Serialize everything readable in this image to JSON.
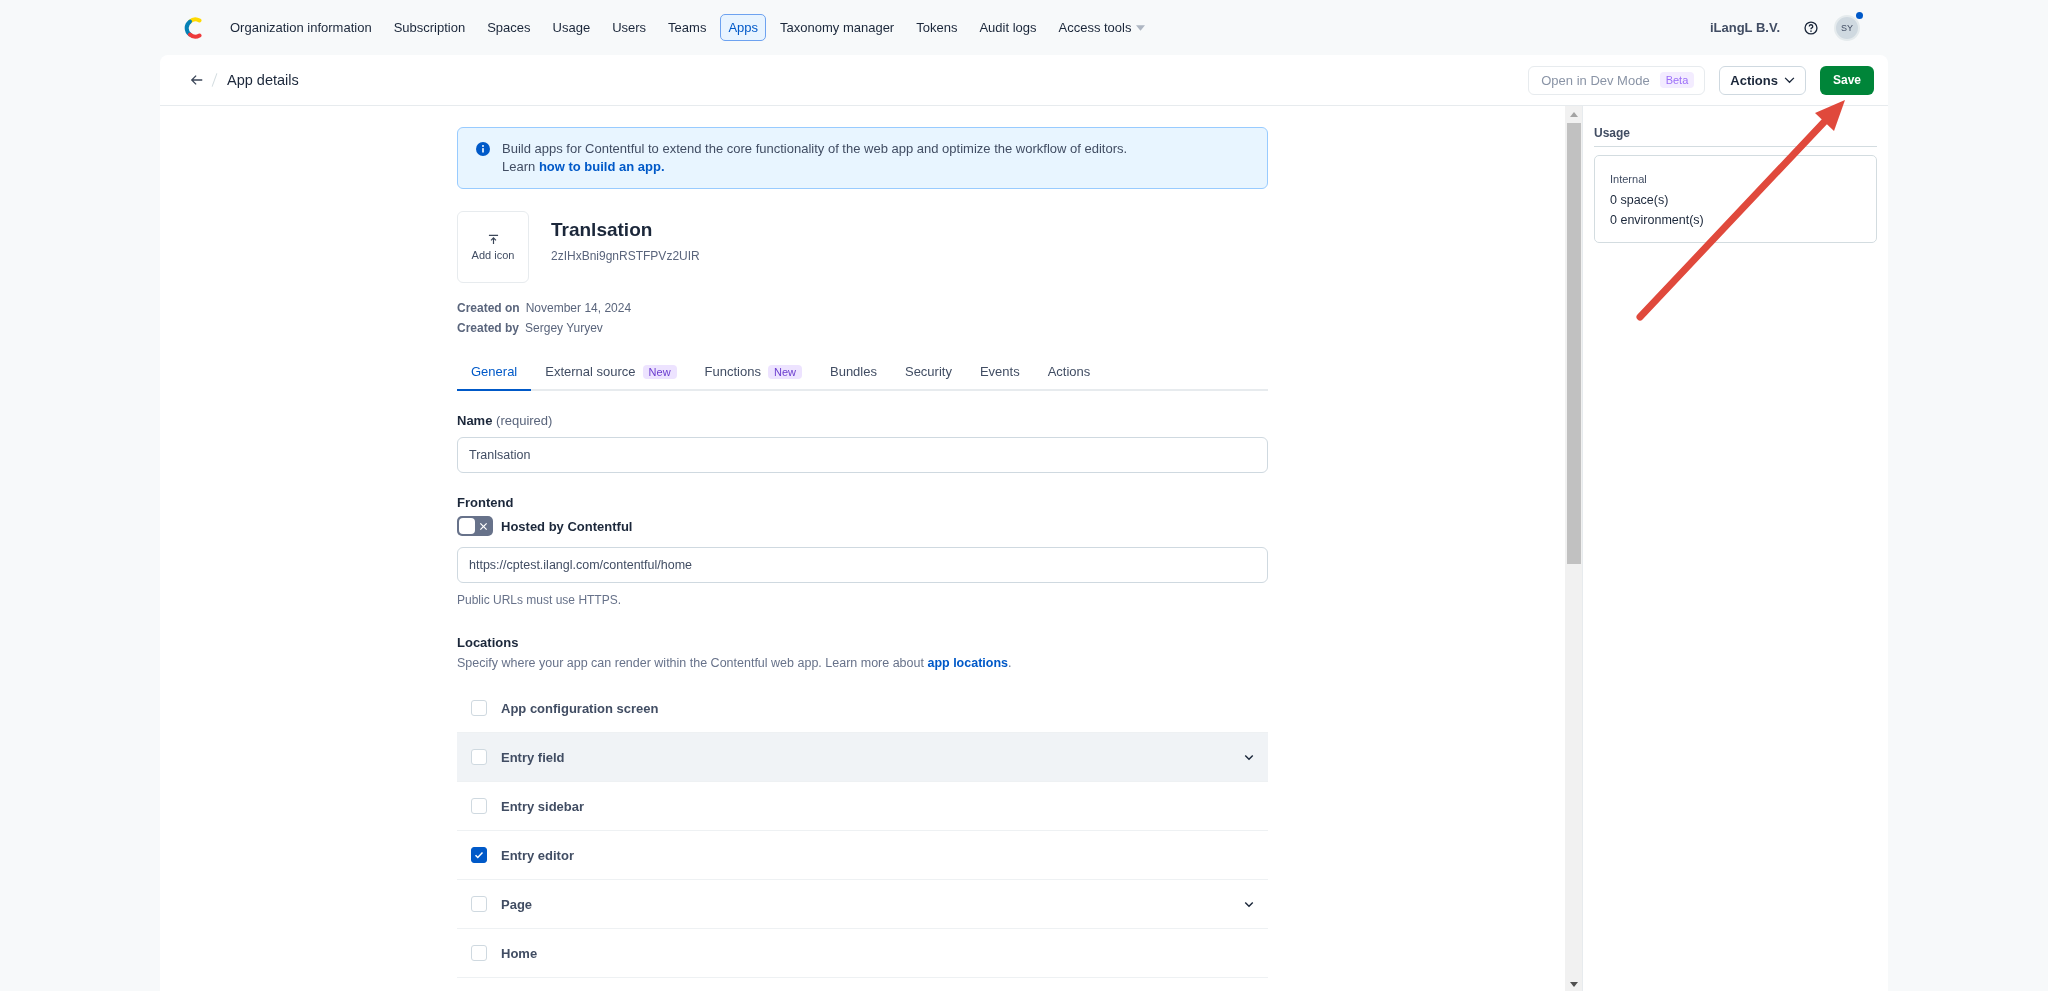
{
  "nav": {
    "items": [
      {
        "label": "Organization information",
        "selected": false,
        "kind": "link"
      },
      {
        "label": "Subscription",
        "selected": false,
        "kind": "link"
      },
      {
        "label": "Spaces",
        "selected": false,
        "kind": "link"
      },
      {
        "label": "Usage",
        "selected": false,
        "kind": "link"
      },
      {
        "label": "Users",
        "selected": false,
        "kind": "link"
      },
      {
        "label": "Teams",
        "selected": false,
        "kind": "link"
      },
      {
        "label": "Apps",
        "selected": true,
        "kind": "link"
      },
      {
        "label": "Taxonomy manager",
        "selected": false,
        "kind": "link"
      },
      {
        "label": "Tokens",
        "selected": false,
        "kind": "link"
      },
      {
        "label": "Audit logs",
        "selected": false,
        "kind": "link"
      },
      {
        "label": "Access tools",
        "selected": false,
        "kind": "menu"
      }
    ],
    "organization": "iLangL B.V.",
    "avatar_initials": "SY",
    "has_notification": true
  },
  "header": {
    "title": "App details",
    "dev_mode": {
      "label": "Open in Dev Mode",
      "badge": "Beta",
      "disabled": true
    },
    "actions": "Actions",
    "save": "Save"
  },
  "info": {
    "text": "Build apps for Contentful to extend the core functionality of the web app and optimize the workflow of editors.",
    "learn": "Learn",
    "link": "how to build an app."
  },
  "app": {
    "icon_label": "Add icon",
    "name": "Tranlsation",
    "id": "2zIHxBni9gnRSTFPVz2UIR"
  },
  "meta": [
    {
      "label": "Created on",
      "value": "November 14, 2024"
    },
    {
      "label": "Created by",
      "value": "Sergey Yuryev"
    }
  ],
  "tabs": [
    {
      "label": "General",
      "selected": true
    },
    {
      "label": "External source",
      "badge": "New",
      "selected": false
    },
    {
      "label": "Functions",
      "badge": "New",
      "selected": false
    },
    {
      "label": "Bundles",
      "selected": false
    },
    {
      "label": "Security",
      "selected": false
    },
    {
      "label": "Events",
      "selected": false
    },
    {
      "label": "Actions",
      "selected": false
    }
  ],
  "form": {
    "name": {
      "label": "Name",
      "hint": "(required)",
      "value": "Tranlsation"
    },
    "frontend": {
      "label": "Frontend",
      "toggle": {
        "label": "Hosted by Contentful",
        "on": false
      },
      "url": "https://cptest.ilangl.com/contentful/home",
      "help": "Public URLs must use HTTPS."
    },
    "locations": {
      "title": "Locations",
      "description": "Specify where your app can render within the Contentful web app. Learn more about ",
      "link": "app locations",
      "after": ".",
      "items": [
        {
          "label": "App configuration screen",
          "checked": false,
          "expandable": false,
          "highlighted": false
        },
        {
          "label": "Entry field",
          "checked": false,
          "expandable": true,
          "highlighted": true
        },
        {
          "label": "Entry sidebar",
          "checked": false,
          "expandable": false,
          "highlighted": false
        },
        {
          "label": "Entry editor",
          "checked": true,
          "expandable": false,
          "highlighted": false
        },
        {
          "label": "Page",
          "checked": false,
          "expandable": true,
          "highlighted": false
        },
        {
          "label": "Home",
          "checked": false,
          "expandable": false,
          "highlighted": false
        }
      ]
    }
  },
  "usage": {
    "title": "Usage",
    "type": "Internal",
    "lines": [
      "0 space(s)",
      "0 environment(s)"
    ]
  }
}
